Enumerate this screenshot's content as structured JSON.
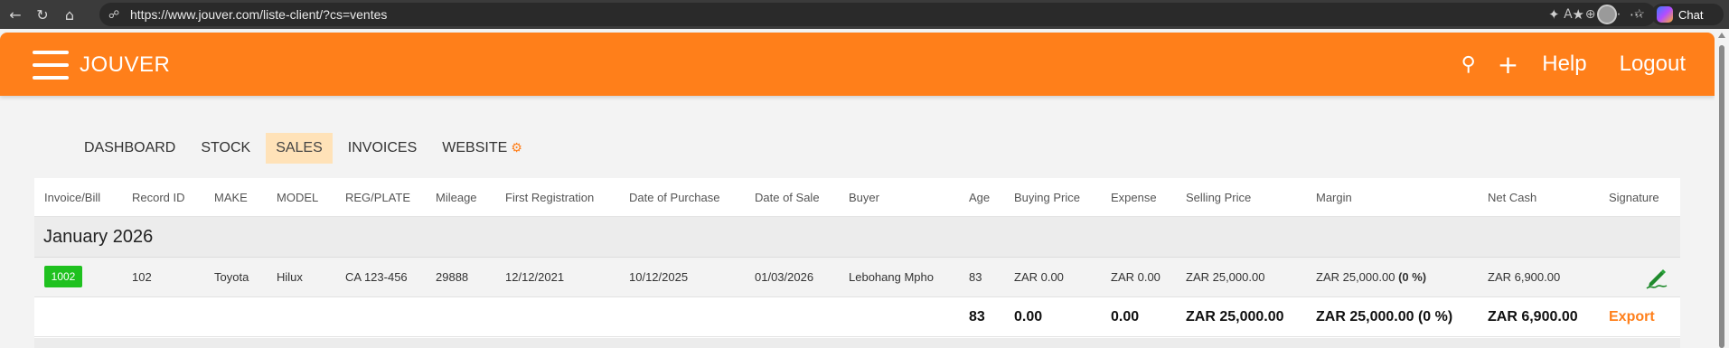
{
  "browser": {
    "url": "https://www.jouver.com/liste-client/?cs=ventes",
    "chat_label": "Chat"
  },
  "header": {
    "brand": "JOUVER",
    "help": "Help",
    "logout": "Logout"
  },
  "tabs": [
    {
      "label": "DASHBOARD"
    },
    {
      "label": "STOCK"
    },
    {
      "label": "SALES"
    },
    {
      "label": "INVOICES"
    },
    {
      "label": "WEBSITE"
    }
  ],
  "table": {
    "columns": [
      "Invoice/Bill",
      "Record ID",
      "MAKE",
      "MODEL",
      "REG/PLATE",
      "Mileage",
      "First Registration",
      "Date of Purchase",
      "Date of Sale",
      "Buyer",
      "Age",
      "Buying Price",
      "Expense",
      "Selling Price",
      "Margin",
      "Net Cash",
      "Signature"
    ],
    "group": "January 2026",
    "row": {
      "invoice": "1002",
      "record_id": "102",
      "make": "Toyota",
      "model": "Hilux",
      "plate": "CA 123-456",
      "mileage": "29888",
      "first_registration": "12/12/2021",
      "date_of_purchase": "10/12/2025",
      "date_of_sale": "01/03/2026",
      "buyer": "Lebohang Mpho",
      "age": "83",
      "buying_price": "ZAR 0.00",
      "expense": "ZAR 0.00",
      "selling_price": "ZAR 25,000.00",
      "margin": "ZAR 25,000.00",
      "margin_pct": "(0 %)",
      "net_cash": "ZAR 6,900.00"
    },
    "totals": {
      "age": "83",
      "buying_price": "0.00",
      "expense": "0.00",
      "selling_price": "ZAR 25,000.00",
      "margin": "ZAR 25,000.00 (0 %)",
      "net_cash": "ZAR 6,900.00",
      "export": "Export"
    }
  }
}
